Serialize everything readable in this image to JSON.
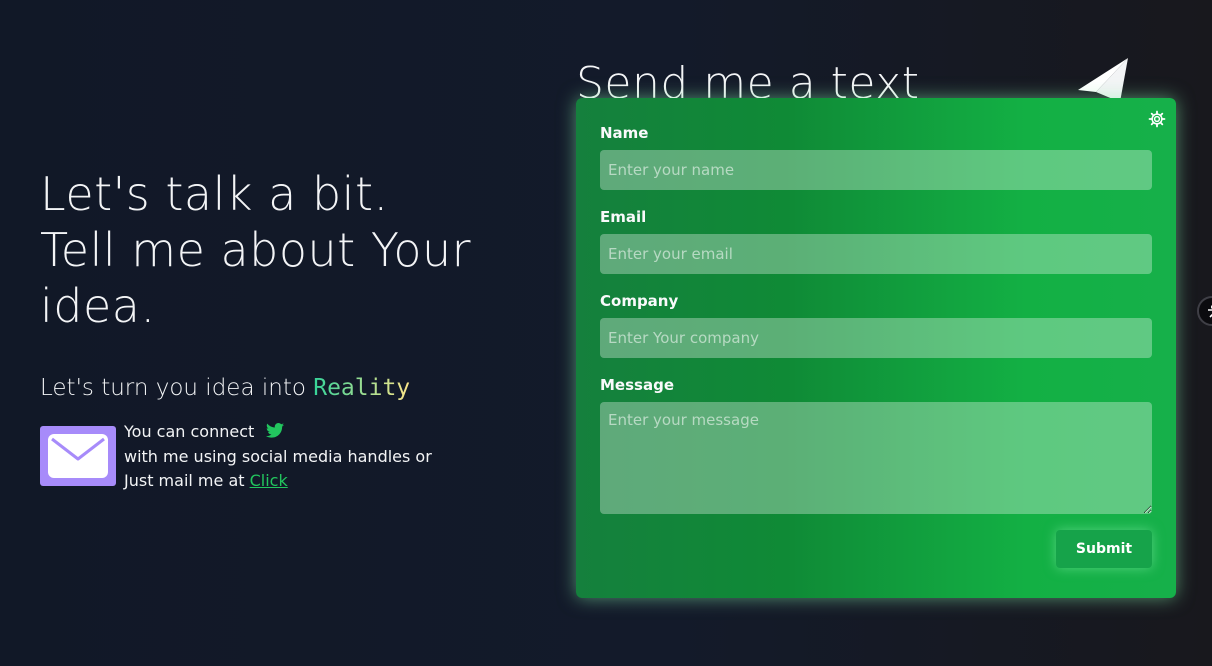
{
  "hero": {
    "line1": "Let's talk a bit.",
    "line2": "Tell me about Your",
    "line3": "idea.",
    "tagline_prefix": "Let's turn you idea into ",
    "tagline_highlight": "Reality"
  },
  "contact": {
    "line1": "You can connect",
    "line2": "with me using social media handles or",
    "line3_prefix": "Just mail me at ",
    "link_text": "Click",
    "mail_icon": "mail-icon",
    "social_icon": "twitter-icon"
  },
  "form": {
    "title": "Send me a text",
    "title_icon": "paper-plane-icon",
    "settings_icon": "gear-icon",
    "fields": [
      {
        "label": "Name",
        "placeholder": "Enter your name"
      },
      {
        "label": "Email",
        "placeholder": "Enter your email"
      },
      {
        "label": "Company",
        "placeholder": "Enter Your company"
      },
      {
        "label": "Message",
        "placeholder": "Enter your message"
      }
    ],
    "submit_label": "Submit"
  },
  "colors": {
    "background": "#111827",
    "card_accent": "#16a34a",
    "link": "#22c55e",
    "mail_tile": "#a78bfa",
    "twitter": "#22c55e"
  }
}
